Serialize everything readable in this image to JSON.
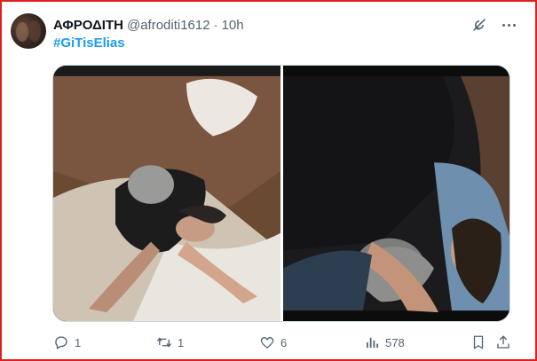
{
  "tweet": {
    "display_name": "ΑΦΡΟΔΙΤΗ",
    "handle": "@afroditi1612",
    "separator": "·",
    "time": "10h",
    "hashtag": "#GiTisElias"
  },
  "icons": {
    "avatar": "profile-avatar",
    "grok": "grok-icon",
    "more": "more-options-icon"
  },
  "actions": {
    "reply_count": "1",
    "retweet_count": "1",
    "like_count": "6",
    "views_count": "578"
  },
  "colors": {
    "accent": "#1d9bf0",
    "muted": "#536471",
    "border": "#e0201c"
  }
}
